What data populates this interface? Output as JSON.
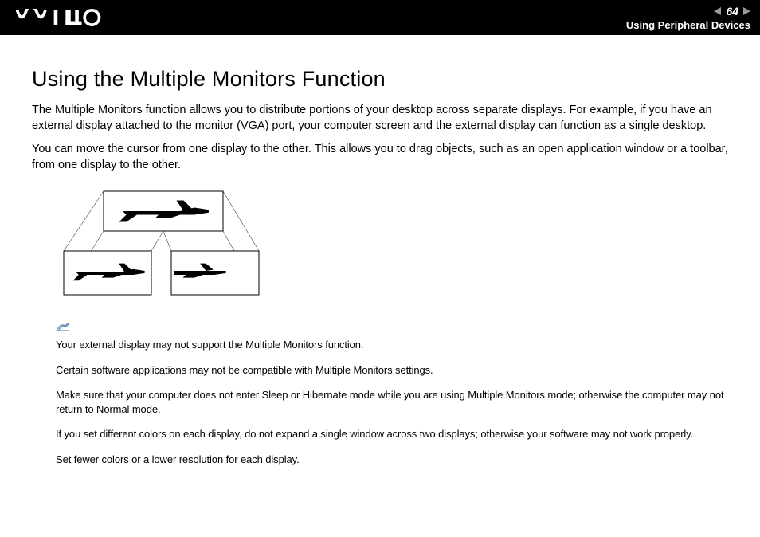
{
  "header": {
    "page_number": "64",
    "section": "Using Peripheral Devices"
  },
  "title": "Using the Multiple Monitors Function",
  "paragraphs": [
    "The Multiple Monitors function allows you to distribute portions of your desktop across separate displays. For example, if you have an external display attached to the monitor (VGA) port, your computer screen and the external display can function as a single desktop.",
    "You can move the cursor from one display to the other. This allows you to drag objects, such as an open application window or a toolbar, from one display to the other."
  ],
  "notes": [
    "Your external display may not support the Multiple Monitors function.",
    "Certain software applications may not be compatible with Multiple Monitors settings.",
    "Make sure that your computer does not enter Sleep or Hibernate mode while you are using Multiple Monitors mode; otherwise the computer may not return to Normal mode.",
    "If you set different colors on each display, do not expand a single window across two displays; otherwise your software may not work properly.",
    "Set fewer colors or a lower resolution for each display."
  ]
}
